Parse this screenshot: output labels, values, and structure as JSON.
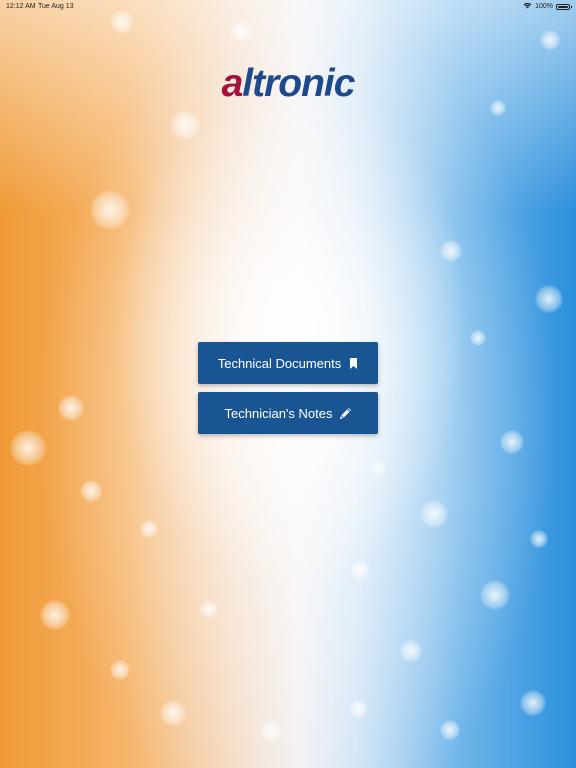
{
  "status_bar": {
    "time": "12:12 AM",
    "date": "Tue Aug 13",
    "battery": "100%",
    "battery_level": 1.0,
    "wifi_icon": "wifi-icon",
    "battery_icon": "battery-icon"
  },
  "logo": {
    "first": "a",
    "rest": "ltronic",
    "colors": {
      "first": "#a3123a",
      "rest": "#1c4a8c"
    }
  },
  "buttons": {
    "technical_documents": {
      "label": "Technical Documents",
      "icon": "bookmark-icon"
    },
    "technicians_notes": {
      "label": "Technician's Notes",
      "icon": "pencil-icon"
    }
  },
  "colors": {
    "button_bg": "#1a5593",
    "button_text": "#ffffff"
  }
}
